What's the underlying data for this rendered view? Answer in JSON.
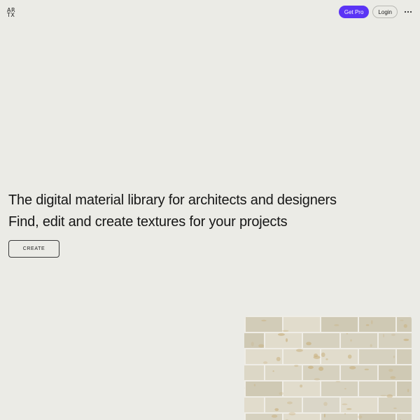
{
  "header": {
    "logo_top": "AR",
    "logo_bottom": "TX",
    "get_pro_label": "Get Pro",
    "login_label": "Login",
    "more_icon": "more-horizontal-icon"
  },
  "hero": {
    "title": "The digital material library for architects and designers",
    "subtitle": "Find, edit and create textures for your projects",
    "create_label": "CREATE"
  },
  "texture": {
    "name": "travertine-brick-texture",
    "base_color": "#dcd7c6",
    "grout_color": "#efede6",
    "stain_color": "#c9b17f"
  },
  "colors": {
    "background": "#ebebe6",
    "accent": "#5b34f5",
    "text": "#161616"
  }
}
